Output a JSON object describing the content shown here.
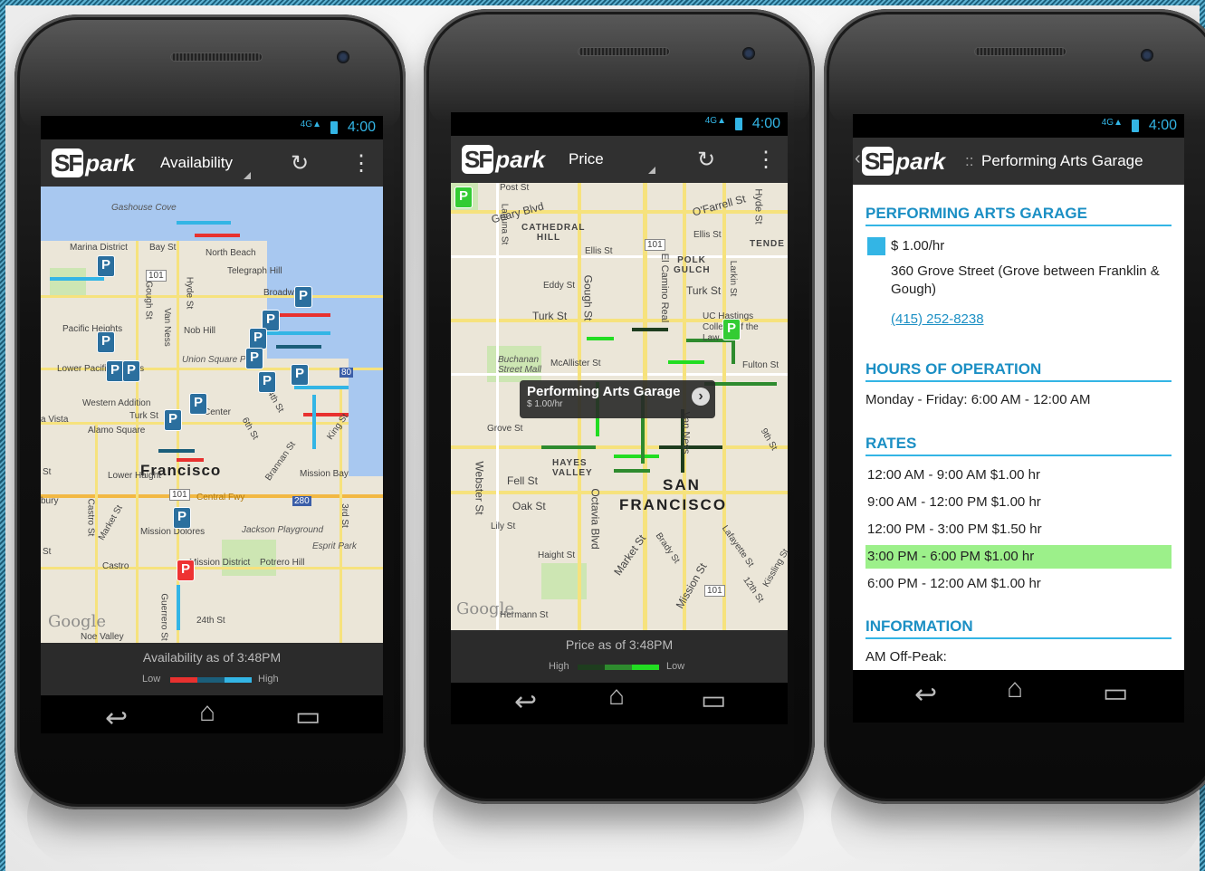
{
  "phone1": {
    "status_time": "4:00",
    "app_logo_sf": "SF",
    "app_logo_park": "park",
    "view_title": "Availability",
    "refresh_icon": "refresh-icon",
    "menu_icon": "overflow-menu-icon",
    "map_labels": {
      "gashouse": "Gashouse Cove",
      "marina": "Marina District",
      "bay_st": "Bay St",
      "north_beach": "North Beach",
      "telegraph": "Telegraph Hill",
      "broadway": "Broadway",
      "pacific": "Pacific Heights",
      "nob_hill": "Nob Hill",
      "lower_pacific": "Lower Pacific Heights",
      "union_sq": "Union Square Park",
      "western_add": "Western Addition",
      "alamo": "Alamo Square",
      "center": "Center",
      "turk_st": "Turk St",
      "francisco": "Francisco",
      "lower_haight": "Lower Haight",
      "central_fwy": "Central Fwy",
      "mission_bay": "Mission Bay",
      "jackson": "Jackson Playground",
      "esprit": "Esprit Park",
      "castro": "Castro",
      "mission_dist": "Mission District",
      "potrero": "Potrero Hill",
      "mission_dolores": "Mission Dolores",
      "noe": "Noe Valley",
      "st24": "24th St",
      "vista": "a Vista",
      "gough": "Gough St",
      "van_ness": "Van Ness",
      "hyde": "Hyde St",
      "market": "Market St",
      "castro_st": "Castro St",
      "guerrero": "Guerrero St",
      "third": "3rd St",
      "brannan": "Brannan St",
      "sixth": "6th St",
      "fourth": "4th St",
      "king": "King St",
      "st": "St",
      "bury": "bury",
      "r101a": "101",
      "r101b": "101",
      "r80": "80",
      "r280": "280"
    },
    "google": "Google",
    "footer_text": "Availability as of 3:48PM",
    "legend_low": "Low",
    "legend_high": "High",
    "legend_colors": [
      "#e8312f",
      "#1b5e7a",
      "#33b5e5"
    ]
  },
  "phone2": {
    "status_time": "4:00",
    "app_logo_sf": "SF",
    "app_logo_park": "park",
    "view_title": "Price",
    "map_labels": {
      "post": "Post St",
      "geary": "Geary Blvd",
      "ofarrell": "O'Farrell St",
      "hyde": "Hyde St",
      "cathedral": "CATHEDRAL HILL",
      "tende": "TENDE",
      "ellis1": "Ellis St",
      "ellis2": "Ellis St",
      "polk": "POLK GULCH",
      "eddy": "Eddy St",
      "turk1": "Turk St",
      "turk2": "Turk St",
      "uc": "UC Hastings College of the Law",
      "buchanan": "Buchanan Street Mall",
      "mcallister": "McAllister St",
      "fulton": "Fulton St",
      "grove": "Grove St",
      "hayes": "HAYES VALLEY",
      "fell": "Fell St",
      "oak": "Oak St",
      "lily": "Lily St",
      "san": "SAN",
      "francisco": "FRANCISCO",
      "ninth": "9th St",
      "webster": "Webster St",
      "octavia": "Octavia Blvd",
      "market": "Market St",
      "haight": "Haight St",
      "brady": "Brady St",
      "mission": "Mission St",
      "lafayette": "Lafayette St",
      "twelfth": "12th St",
      "kissling": "Kissling St",
      "hermann": "Hermann St",
      "laguna": "Laguna St",
      "gough": "Gough St",
      "el_camino": "El Camino Real",
      "larkin": "Larkin St",
      "van_ness": "Van Ness",
      "r101a": "101",
      "r101b": "101"
    },
    "callout_title": "Performing Arts Garage",
    "callout_sub": "$ 1.00/hr",
    "google": "Google",
    "footer_text": "Price as of 3:48PM",
    "legend_high": "High",
    "legend_low": "Low",
    "legend_colors": [
      "#1e3d1e",
      "#2e8b2e",
      "#22dd22"
    ]
  },
  "phone3": {
    "status_time": "4:00",
    "app_logo_sf": "SF",
    "app_logo_park": "park",
    "view_title": "Performing Arts Garage",
    "title_sep": "::",
    "section_name": "PERFORMING ARTS GARAGE",
    "price": "$ 1.00/hr",
    "address": "360 Grove Street (Grove between Franklin & Gough)",
    "phone": "(415) 252-8238",
    "hours_heading": "HOURS OF OPERATION",
    "hours": "Monday - Friday: 6:00 AM - 12:00 AM",
    "rates_heading": "RATES",
    "rates": [
      "12:00 AM - 9:00 AM  $1.00 hr",
      "9:00 AM - 12:00 PM  $1.00 hr",
      "12:00 PM - 3:00 PM  $1.50 hr",
      "3:00 PM - 6:00 PM  $1.00 hr",
      "6:00 PM - 12:00 AM  $1.00 hr"
    ],
    "highlight_color": "#9cf08a",
    "info_heading": "INFORMATION",
    "info_first": "AM Off-Peak:"
  }
}
